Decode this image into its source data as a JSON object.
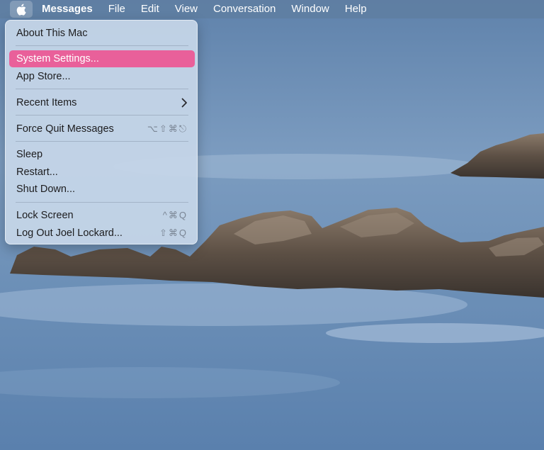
{
  "menubar": {
    "apple_icon": "apple-logo",
    "app_name": "Messages",
    "menus": [
      "File",
      "Edit",
      "View",
      "Conversation",
      "Window",
      "Help"
    ]
  },
  "apple_menu": {
    "highlight_color": "#e9609a",
    "items": {
      "about": "About This Mac",
      "system_settings": "System Settings...",
      "app_store": "App Store...",
      "recent_items": "Recent Items",
      "force_quit": "Force Quit Messages",
      "force_quit_shortcut": "⌥⇧⌘⎋",
      "sleep": "Sleep",
      "restart": "Restart...",
      "shut_down": "Shut Down...",
      "lock_screen": "Lock Screen",
      "lock_screen_shortcut": "^⌘Q",
      "log_out": "Log Out Joel Lockard...",
      "log_out_shortcut": "⇧⌘Q"
    }
  }
}
